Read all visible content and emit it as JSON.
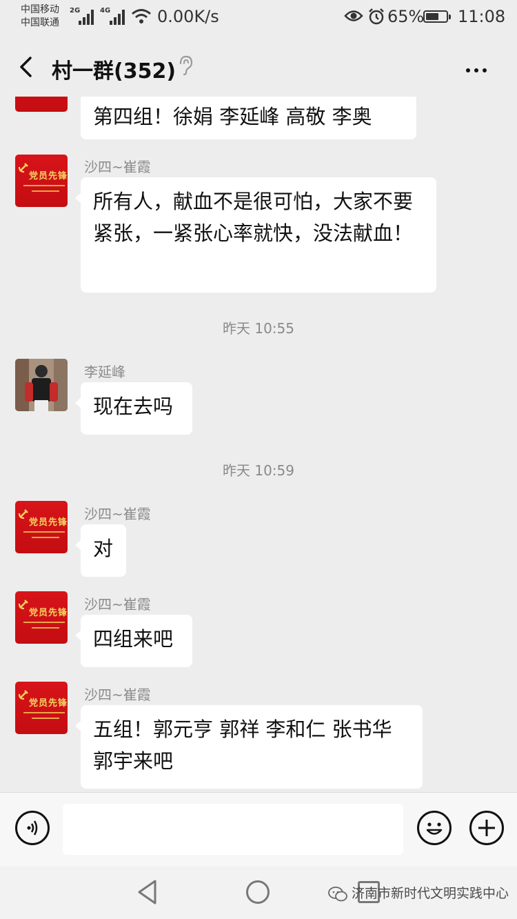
{
  "status_bar": {
    "carrier1": "中国移动",
    "carrier2": "中国联通",
    "net1": "2G",
    "net2": "4G",
    "speed": "0.00K/s",
    "battery_percent": "65%",
    "battery_level": 0.65,
    "time": "11:08"
  },
  "header": {
    "title": "村一群(352)",
    "back_icon": "chevron-left-icon",
    "mute_icon": "ear-icon",
    "more_icon": "more-dots-icon"
  },
  "messages": [
    {
      "sender": "",
      "avatar": "party-avatar",
      "text": "第四组！徐娟  李延峰 高敬  李奥"
    },
    {
      "sender": "沙四~崔霞",
      "avatar": "party-avatar",
      "text": "所有人，献血不是很可怕，大家不要紧张，一紧张心率就快，没法献血！"
    },
    {
      "time": "昨天 10:55"
    },
    {
      "sender": "李延峰",
      "avatar": "photo-avatar",
      "text": "现在去吗"
    },
    {
      "time": "昨天 10:59"
    },
    {
      "sender": "沙四~崔霞",
      "avatar": "party-avatar",
      "text": "对"
    },
    {
      "sender": "沙四~崔霞",
      "avatar": "party-avatar",
      "text": "四组来吧"
    },
    {
      "sender": "沙四~崔霞",
      "avatar": "party-avatar",
      "text": "五组！郭元亨  郭祥  李和仁  张书华  郭宇来吧"
    }
  ],
  "avatar_text": "党员先锋岗",
  "input_bar": {
    "voice_icon": "voice-icon",
    "emoji_icon": "emoji-icon",
    "plus_icon": "plus-icon",
    "value": ""
  },
  "nav_bar": {
    "back_icon": "nav-back-icon",
    "home_icon": "nav-home-icon",
    "recent_icon": "nav-recent-icon"
  },
  "watermark": "济南市新时代文明实践中心"
}
